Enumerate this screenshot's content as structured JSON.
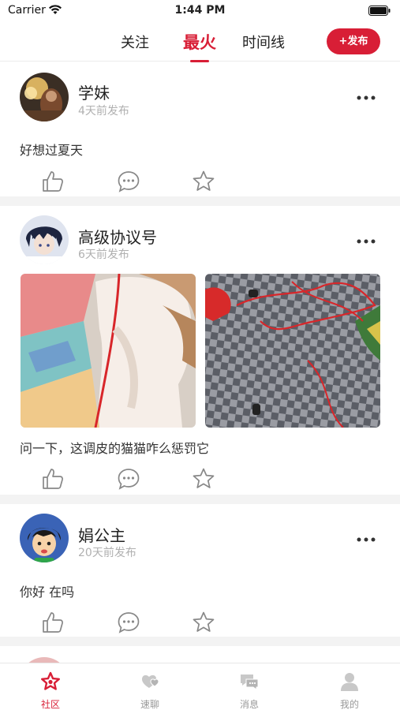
{
  "status_bar": {
    "carrier": "Carrier",
    "time": "1:44 PM"
  },
  "top_tabs": [
    {
      "label": "关注",
      "active": false
    },
    {
      "label": "最火",
      "active": true
    },
    {
      "label": "时间线",
      "active": false
    }
  ],
  "publish_button": "+发布",
  "posts": [
    {
      "name": "学妹",
      "time": "4天前发布",
      "text": "好想过夏天",
      "images": 0
    },
    {
      "name": "高级协议号",
      "time": "6天前发布",
      "text": "问一下，这调皮的猫猫咋么惩罚它",
      "images": 2
    },
    {
      "name": "娟公主",
      "time": "20天前发布",
      "text": "你好 在吗",
      "images": 0
    }
  ],
  "bottom_nav": [
    {
      "label": "社区",
      "icon": "star-icon",
      "active": true
    },
    {
      "label": "速聊",
      "icon": "heart-chat-icon",
      "active": false
    },
    {
      "label": "消息",
      "icon": "message-icon",
      "active": false
    },
    {
      "label": "我的",
      "icon": "user-icon",
      "active": false
    }
  ],
  "colors": {
    "accent": "#d81e36",
    "muted": "#b0b0b0",
    "separator": "#f3f3f3"
  }
}
